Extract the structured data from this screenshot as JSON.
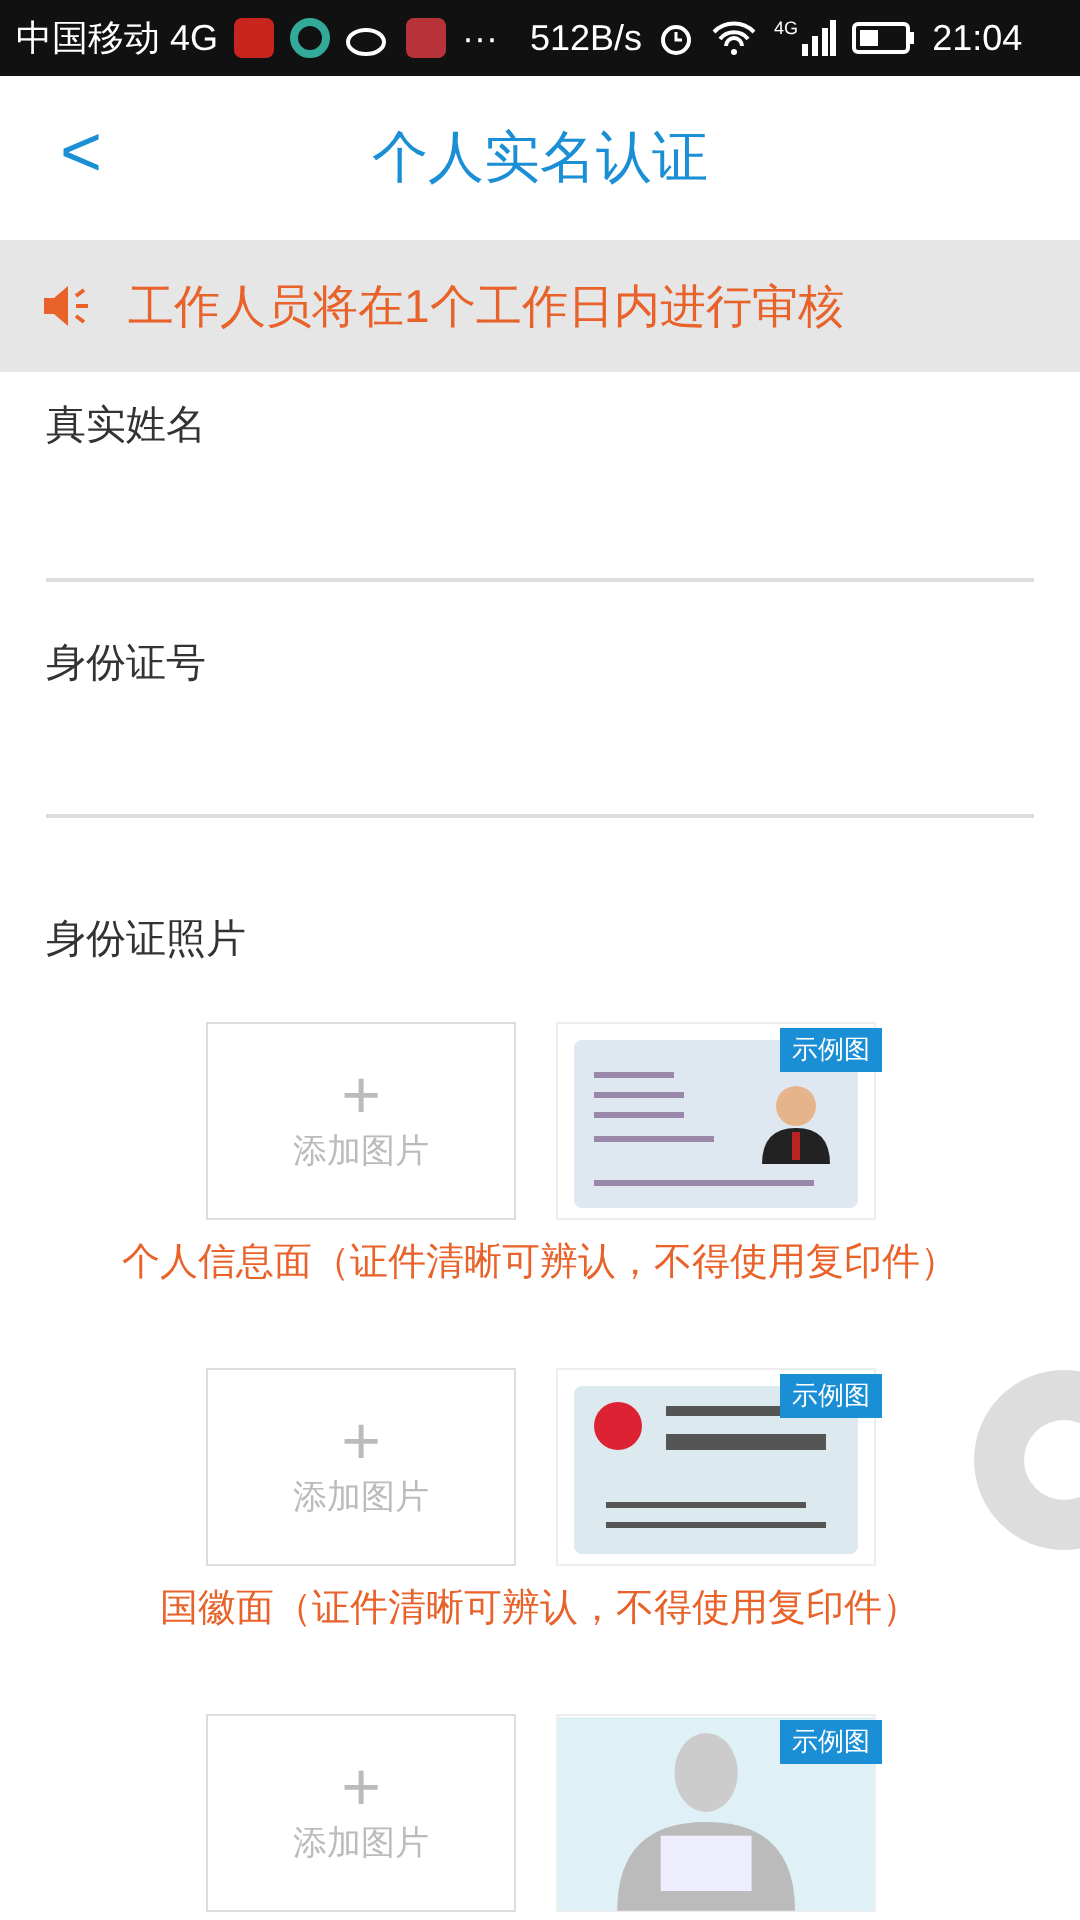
{
  "status_bar": {
    "carrier": "中国移动 4G",
    "dots": "···",
    "speed": "512B/s",
    "network": "4G",
    "time": "21:04"
  },
  "header": {
    "back": "<",
    "title": "个人实名认证"
  },
  "notice": {
    "text": "工作人员将在1个工作日内进行审核"
  },
  "fields": [
    {
      "label": "真实姓名"
    },
    {
      "label": "身份证号"
    }
  ],
  "photos": {
    "label": "身份证照片",
    "items": [
      {
        "kind": "front",
        "add_plus": "+",
        "add_text": "添加图片",
        "sample_badge": "示例图",
        "caption": "个人信息面（证件清晰可辨认，不得使用复印件）"
      },
      {
        "kind": "back",
        "add_plus": "+",
        "add_text": "添加图片",
        "sample_badge": "示例图",
        "caption": "国徽面（证件清晰可辨认，不得使用复印件）"
      },
      {
        "kind": "holding",
        "add_plus": "+",
        "add_text": "添加图片",
        "sample_badge": "示例图"
      }
    ]
  }
}
